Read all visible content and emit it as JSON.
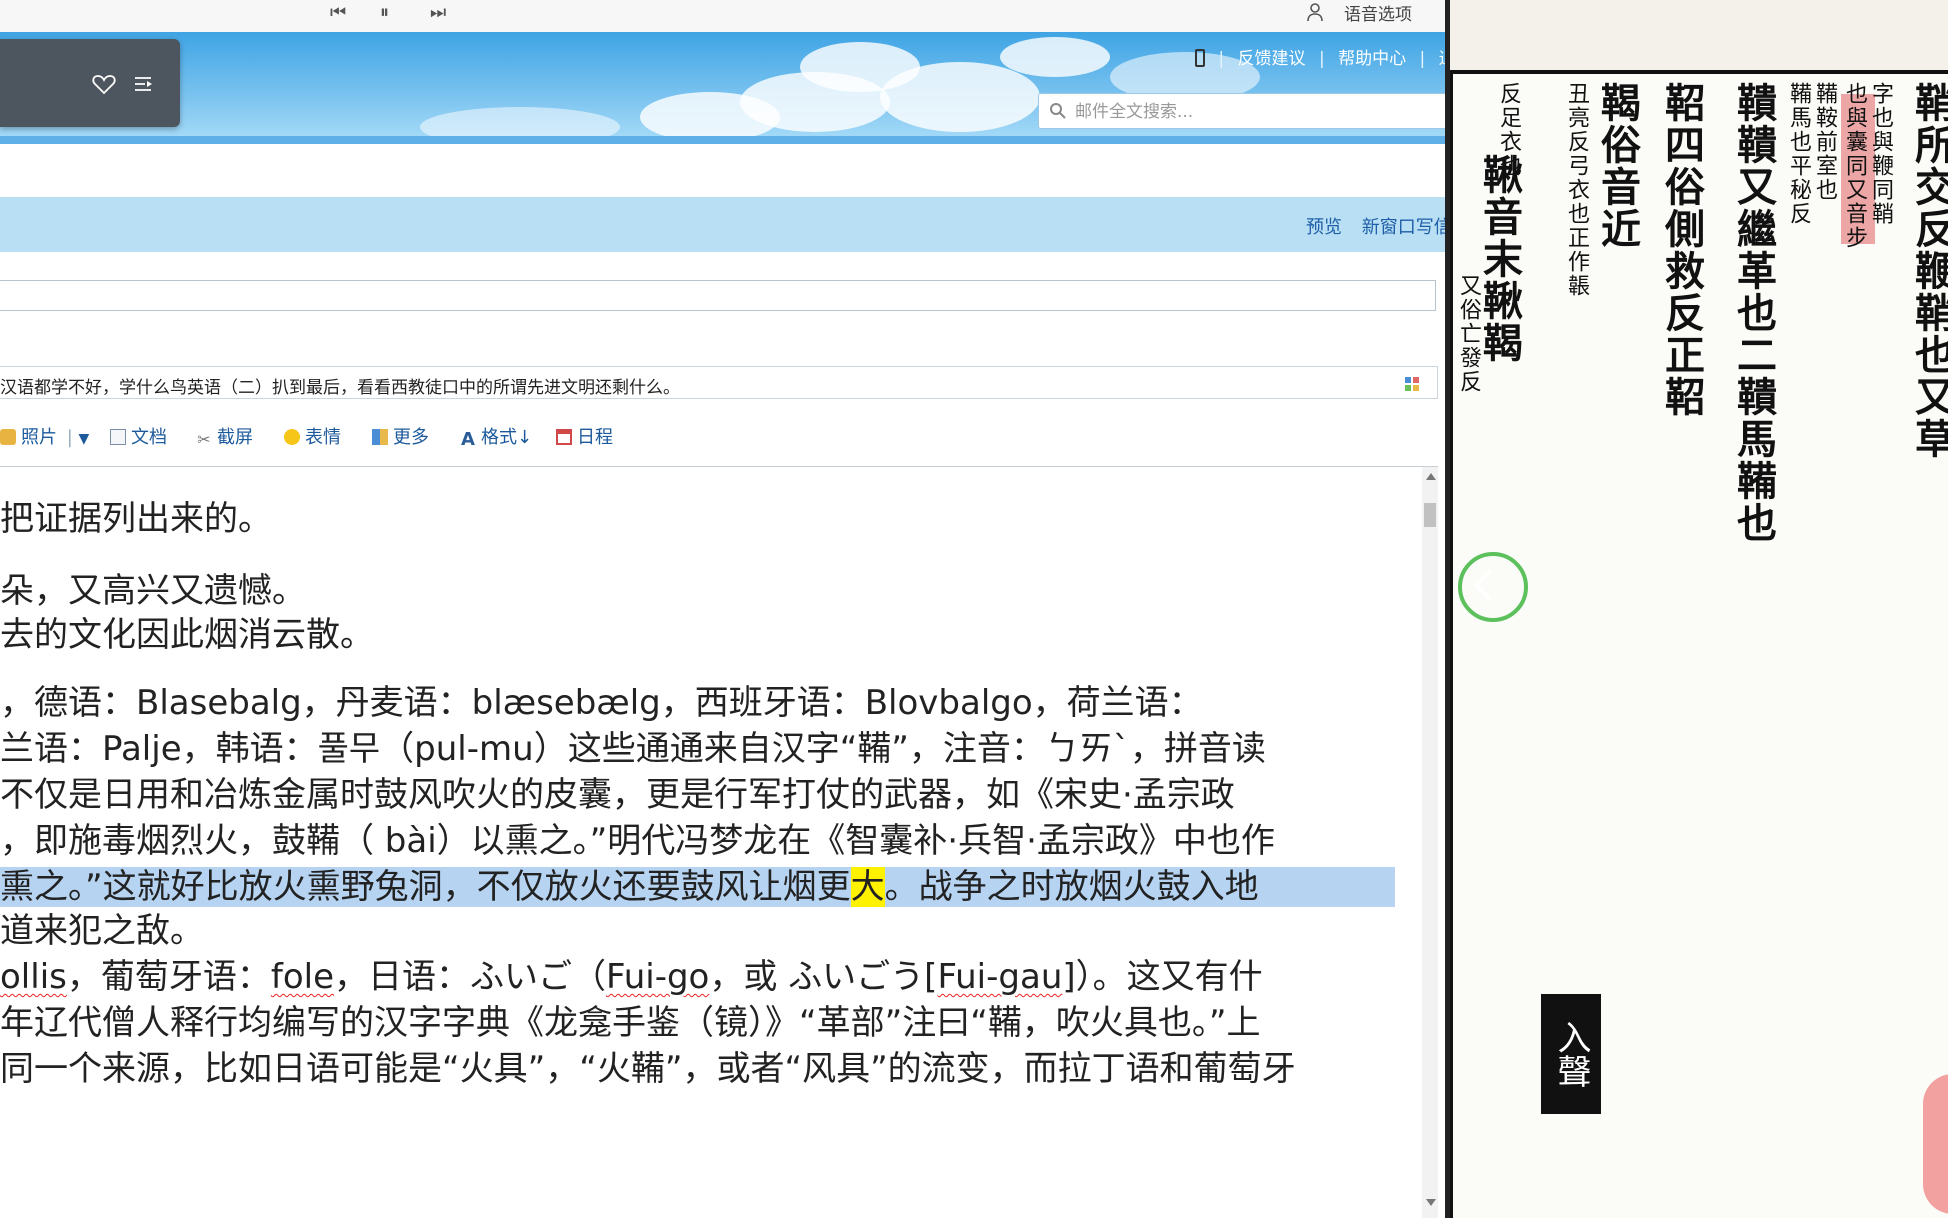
{
  "topbar": {
    "prev_icon": "skip-previous-icon",
    "pause_icon": "pause-icon",
    "next_icon": "skip-next-icon",
    "voice_options": "语音选项"
  },
  "header": {
    "links": [
      "反馈建议",
      "帮助中心",
      "退"
    ],
    "search_placeholder": "邮件全文搜索..."
  },
  "band": {
    "preview": "预览",
    "new_window": "新窗口写信"
  },
  "subject": "汉语都学不好，学什么鸟英语（二）扒到最后，看看西教徒口中的所谓先进文明还剩什么。",
  "toolbar": {
    "photo": "照片",
    "doc": "文档",
    "screenshot": "截屏",
    "emoji": "表情",
    "more": "更多",
    "format": "格式",
    "calendar": "日程"
  },
  "body": {
    "l1": "把证据列出来的。",
    "l2": "朵，又高兴又遗憾。",
    "l3": "去的文化因此烟消云散。",
    "l4": "，德语：Blasebalg，丹麦语：blæsebælg，西班牙语：Blovbalgo，荷兰语：",
    "l5": "兰语：Palje，韩语：풀무（pul-mu）这些通通来自汉字“鞴”，注音：ㄅㄞˋ，拼音读",
    "l6": "不仅是日用和冶炼金属时鼓风吹火的皮囊，更是行军打仗的武器，如《宋史·孟宗政",
    "l7": "，即施毒烟烈火，鼓鞴（ bài）以熏之。”明代冯梦龙在《智囊补·兵智·孟宗政》中也作",
    "l8a": "熏之。”这就好比放火熏野兔洞，不仅放火还要鼓风让烟更",
    "l8b": "大",
    "l8c": "。战争之时放烟火鼓入地",
    "l9": "道来犯之敌。",
    "l10a": "ollis",
    "l10b": "，葡萄牙语：",
    "l10c": "fole",
    "l10d": "，日语：ふいご（",
    "l10e": "Fui-go",
    "l10f": "，或 ふいごう[",
    "l10g": "Fui-gau",
    "l10h": "]）。这又有什",
    "l11": "年辽代僧人释行均编写的汉字字典《龙龛手鉴（镜）》“革部”注曰“鞴，吹火具也。”上",
    "l12": "同一个来源，比如日语可能是“火具”，“火鞴”，或者“风具”的流变，而拉丁语和葡萄牙"
  },
  "scan": {
    "cols": [
      "鞘所交反鞭鞘也又草",
      "字也與鞭同鞘",
      "也與囊同又音步",
      "鞴鞍前室也",
      "鞴馬也平秘反",
      "鞼鞼又繼革也二鞼馬鞴也",
      "鞀四俗側救反正鞀",
      "鞨俗音近",
      "丑亮反弓衣也正作韔",
      "反足衣也",
      "鞦音末鞦鞨",
      "又俗亡發反"
    ],
    "rusheng": "入聲"
  }
}
